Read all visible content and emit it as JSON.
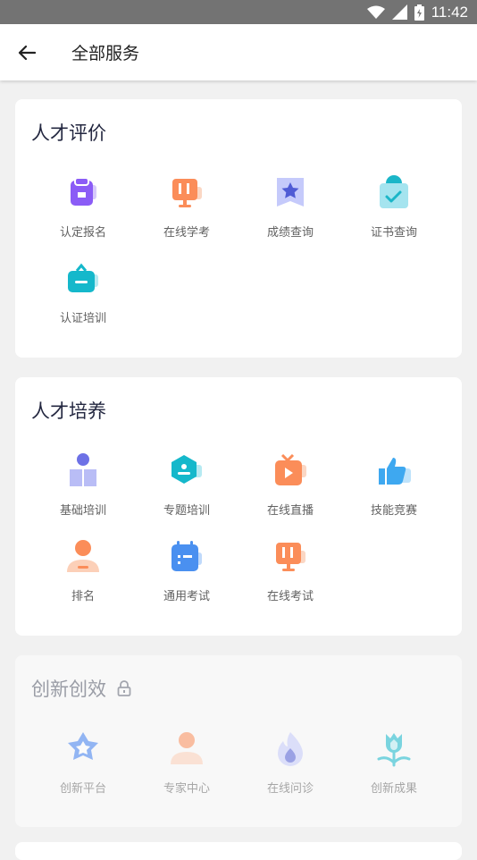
{
  "status": {
    "time": "11:42"
  },
  "header": {
    "title": "全部服务"
  },
  "sections": [
    {
      "title": "人才评价",
      "locked": false,
      "items": [
        {
          "label": "认定报名",
          "icon": "register-icon"
        },
        {
          "label": "在线学考",
          "icon": "online-study-icon"
        },
        {
          "label": "成绩查询",
          "icon": "score-query-icon"
        },
        {
          "label": "证书查询",
          "icon": "certificate-query-icon"
        },
        {
          "label": "认证培训",
          "icon": "certification-training-icon"
        }
      ]
    },
    {
      "title": "人才培养",
      "locked": false,
      "items": [
        {
          "label": "基础培训",
          "icon": "basic-training-icon"
        },
        {
          "label": "专题培训",
          "icon": "topic-training-icon"
        },
        {
          "label": "在线直播",
          "icon": "live-stream-icon"
        },
        {
          "label": "技能竞赛",
          "icon": "skill-contest-icon"
        },
        {
          "label": "排名",
          "icon": "ranking-icon"
        },
        {
          "label": "通用考试",
          "icon": "general-exam-icon"
        },
        {
          "label": "在线考试",
          "icon": "online-exam-icon"
        }
      ]
    },
    {
      "title": "创新创效",
      "locked": true,
      "items": [
        {
          "label": "创新平台",
          "icon": "innovation-platform-icon"
        },
        {
          "label": "专家中心",
          "icon": "expert-center-icon"
        },
        {
          "label": "在线问诊",
          "icon": "online-consult-icon"
        },
        {
          "label": "创新成果",
          "icon": "innovation-result-icon"
        }
      ]
    }
  ]
}
